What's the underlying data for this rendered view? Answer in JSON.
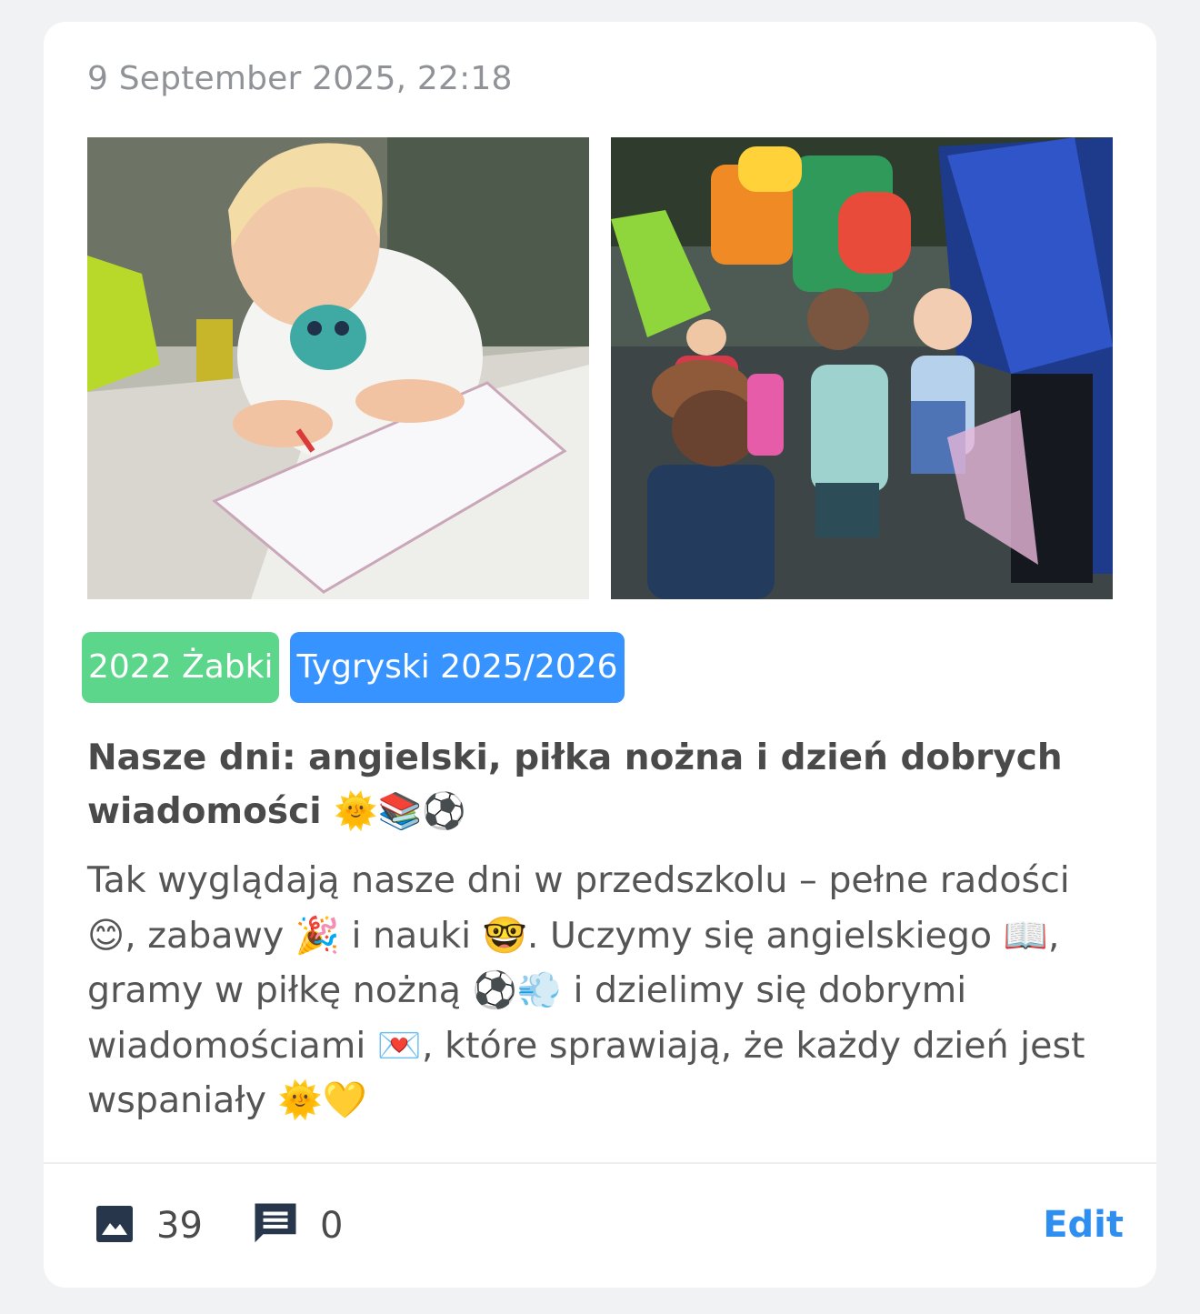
{
  "post": {
    "date": "9 September 2025, 22:18",
    "photos": [
      {
        "alt": "photo-child-drawing"
      },
      {
        "alt": "photo-children-playground"
      }
    ],
    "tags": [
      {
        "label": "2022 Żabki",
        "color": "#5cd68a"
      },
      {
        "label": "Tygryski 2025/2026",
        "color": "#3793ff"
      }
    ],
    "title": "Nasze dni: angielski, piłka nożna i dzień dobrych wiadomości 🌞📚⚽",
    "body": "Tak wyglądają nasze dni w przedszkolu – pełne radości 😊, zabawy 🎉 i nauki 🤓. Uczymy się angielskiego 📖, gramy w piłkę nożną ⚽💨 i dzielimy się dobrymi wiadomościami 💌, które sprawiają, że każdy dzień jest wspaniały 🌞💛"
  },
  "footer": {
    "photo_icon": "image-icon",
    "photo_count": "39",
    "comment_icon": "comment-icon",
    "comment_count": "0",
    "edit_label": "Edit"
  },
  "colors": {
    "accent": "#2f8ff0",
    "tag_green": "#5cd68a",
    "tag_blue": "#3793ff",
    "background": "#f1f2f4",
    "card": "#ffffff"
  }
}
